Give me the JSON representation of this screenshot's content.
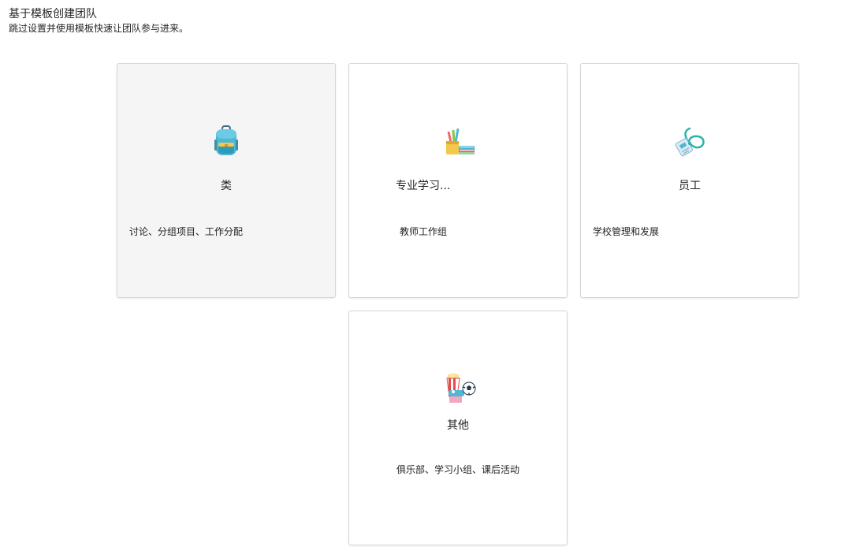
{
  "header": {
    "title": "基于模板创建团队",
    "subtitle": "跳过设置并使用模板快速让团队参与进来。"
  },
  "cards": [
    {
      "title": "类",
      "description": "讨论、分组项目、工作分配",
      "icon": "backpack-icon"
    },
    {
      "title": "专业学习...",
      "description": "教师工作组",
      "icon": "books-pencils-icon"
    },
    {
      "title": "员工",
      "description": "学校管理和发展",
      "icon": "id-badge-lanyard-icon"
    },
    {
      "title": "其他",
      "description": "俱乐部、学习小组、课后活动",
      "icon": "popcorn-soccer-icon"
    }
  ]
}
